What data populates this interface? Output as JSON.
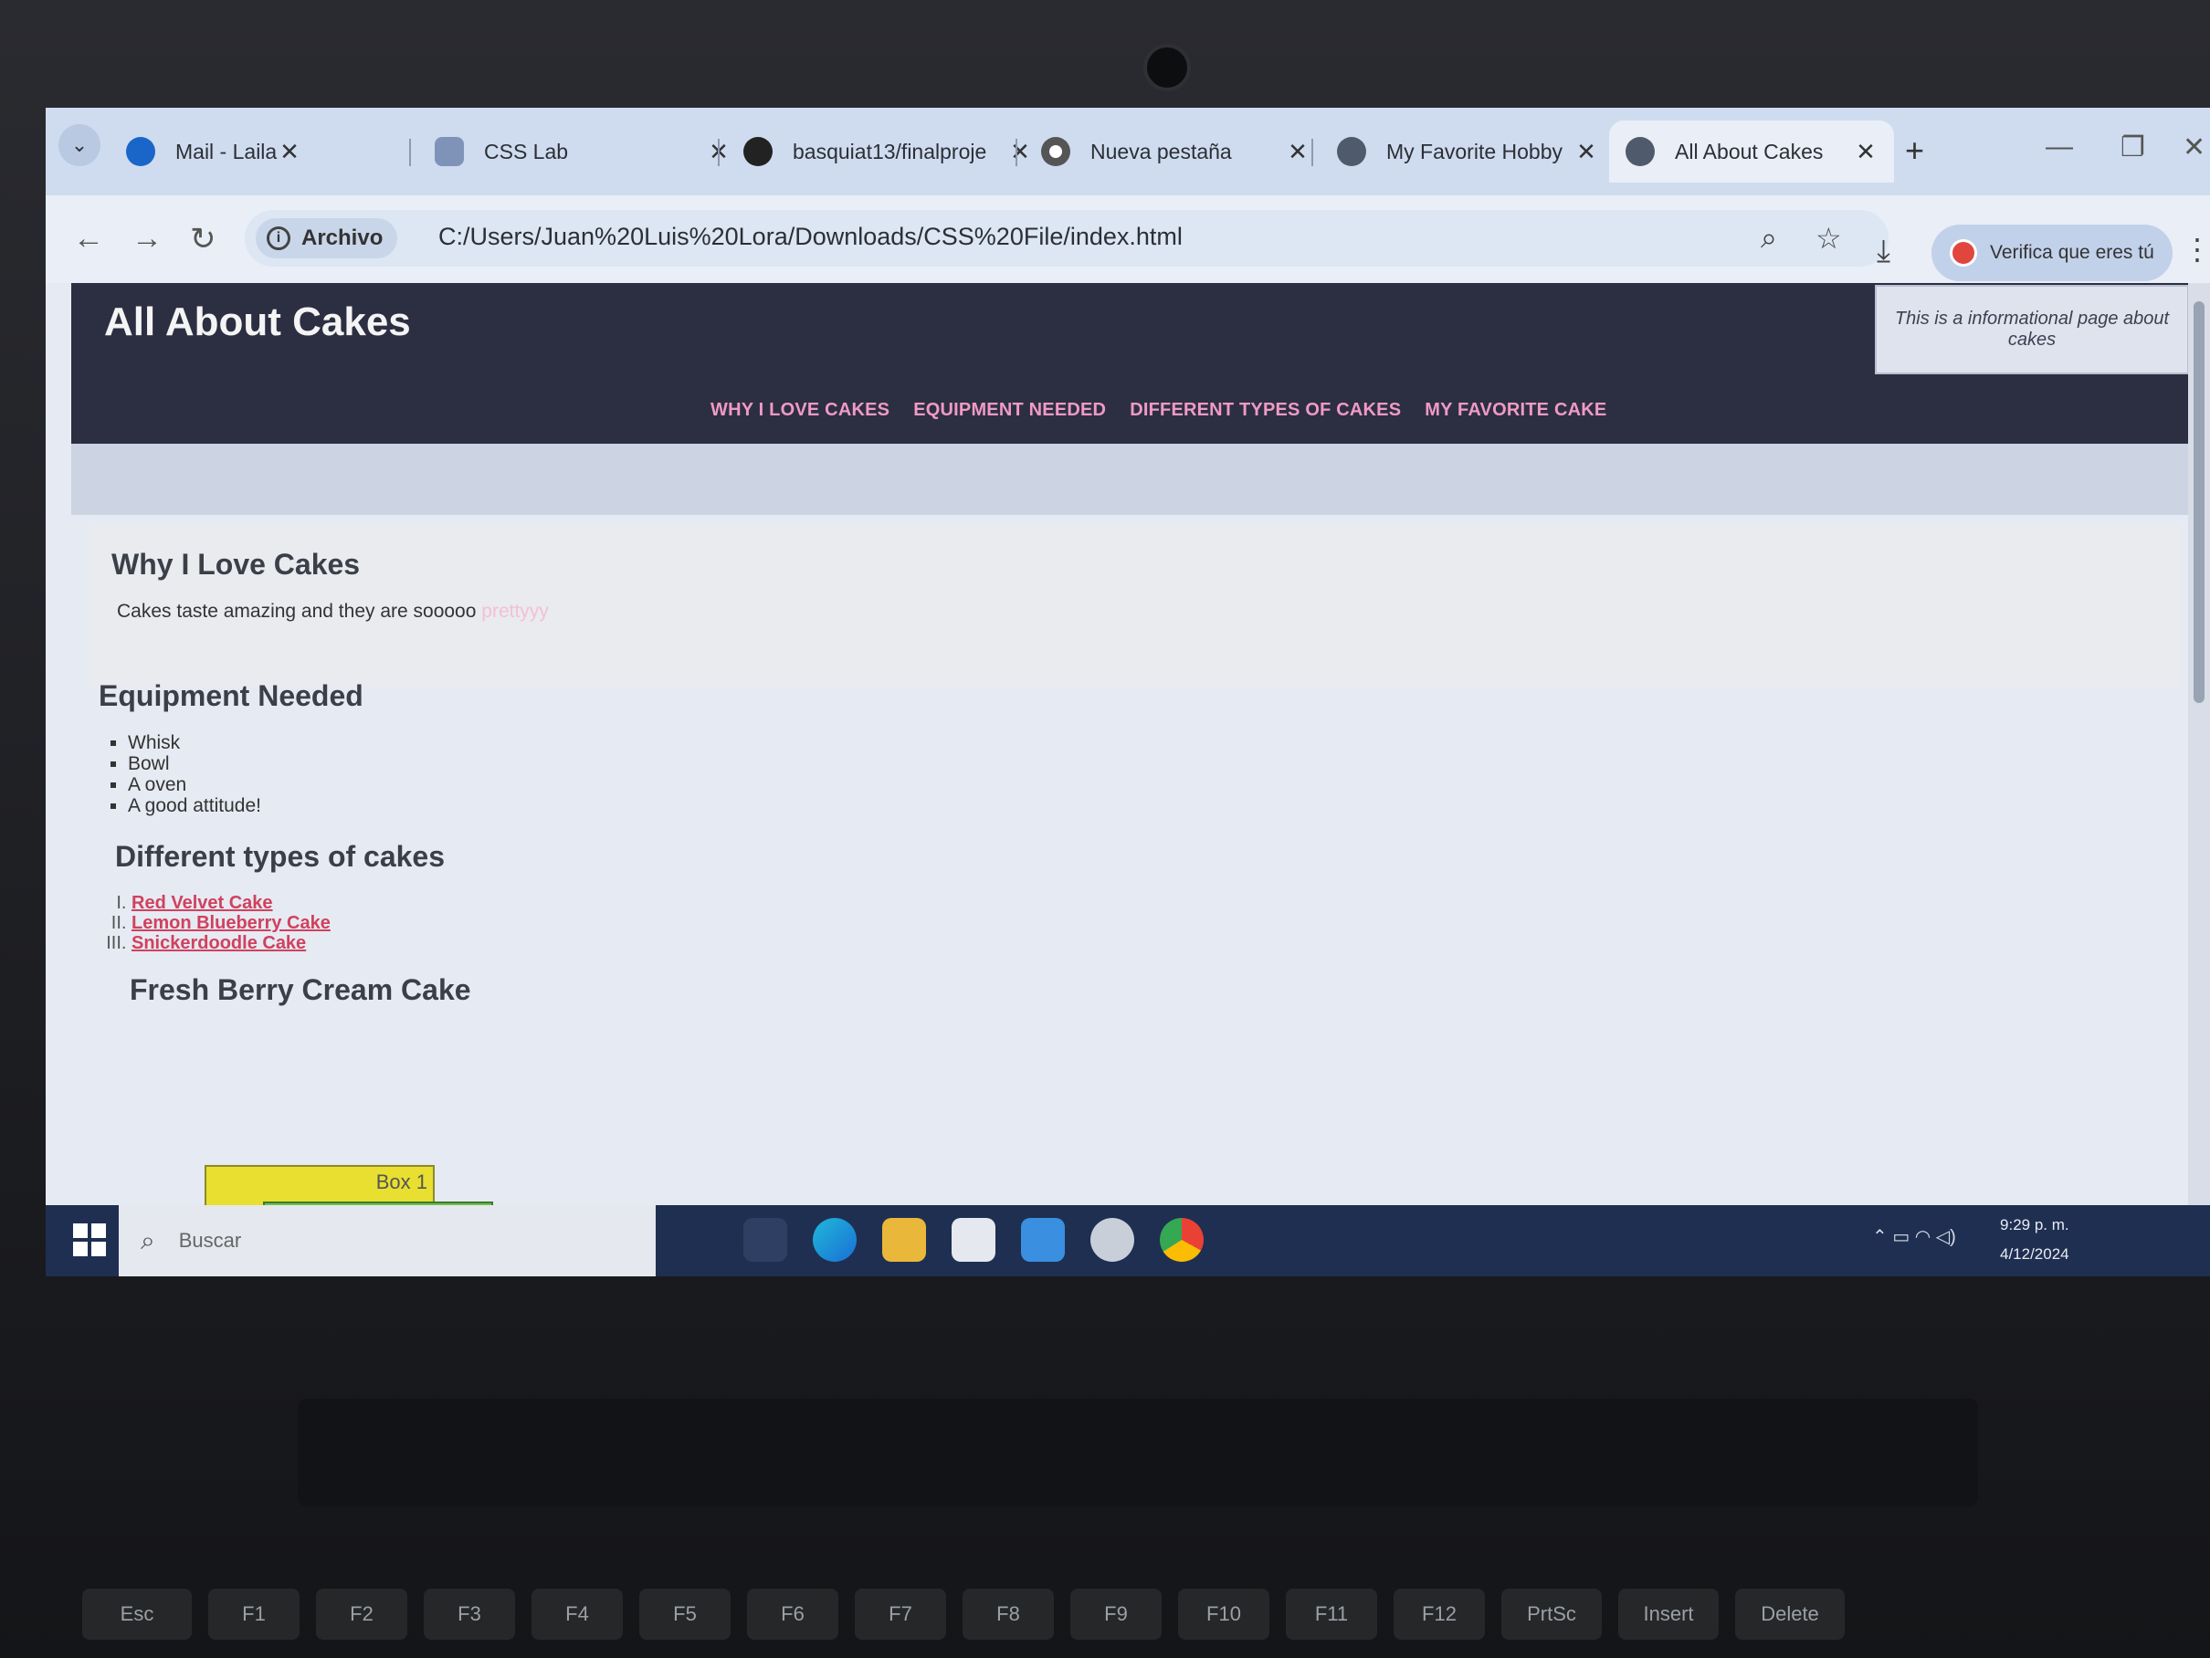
{
  "browser": {
    "tabs": [
      {
        "label": "Mail - Lailah Smith - C",
        "icon": "outlook-icon",
        "active": false
      },
      {
        "label": "CSS Lab",
        "icon": "user-icon",
        "active": false
      },
      {
        "label": "basquiat13/finalproje",
        "icon": "github-icon",
        "active": false
      },
      {
        "label": "Nueva pestaña",
        "icon": "chrome-icon",
        "active": false
      },
      {
        "label": "My Favorite Hobby",
        "icon": "globe-icon",
        "active": false
      },
      {
        "label": "All About Cakes",
        "icon": "globe-icon",
        "active": true
      }
    ],
    "close_glyph": "✕",
    "new_tab_glyph": "+",
    "address": {
      "chip_label": "Archivo",
      "url": "C:/Users/Juan%20Luis%20Lora/Downloads/CSS%20File/index.html"
    },
    "profile_button": "Verifica que eres tú"
  },
  "page": {
    "title": "All About Cakes",
    "tooltip": "This is a informational page about cakes",
    "nav": [
      "WHY I LOVE CAKES",
      "EQUIPMENT NEEDED",
      "DIFFERENT TYPES OF CAKES",
      "MY FAVORITE CAKE"
    ],
    "why": {
      "heading": "Why I Love Cakes",
      "text": "Cakes taste amazing and they are sooooo",
      "highlight": "prettyyy"
    },
    "equipment": {
      "heading": "Equipment Needed",
      "items": [
        "Whisk",
        "Bowl",
        "A oven",
        "A good attitude!"
      ]
    },
    "types": {
      "heading": "Different types of cakes",
      "items": [
        "Red Velvet Cake",
        "Lemon Blueberry Cake",
        "Snickerdoodle Cake"
      ]
    },
    "favorite": {
      "heading": "Fresh Berry Cream Cake"
    },
    "box1_label": "Box 1"
  },
  "taskbar": {
    "search_placeholder": "Buscar",
    "time": "9:29 p. m.",
    "date": "4/12/2024"
  },
  "keyboard": [
    "Esc",
    "F1",
    "F2",
    "F3",
    "F4",
    "F5",
    "F6",
    "F7",
    "F8",
    "F9",
    "F10",
    "F11",
    "F12",
    "PrtSc",
    "Insert",
    "Delete"
  ]
}
